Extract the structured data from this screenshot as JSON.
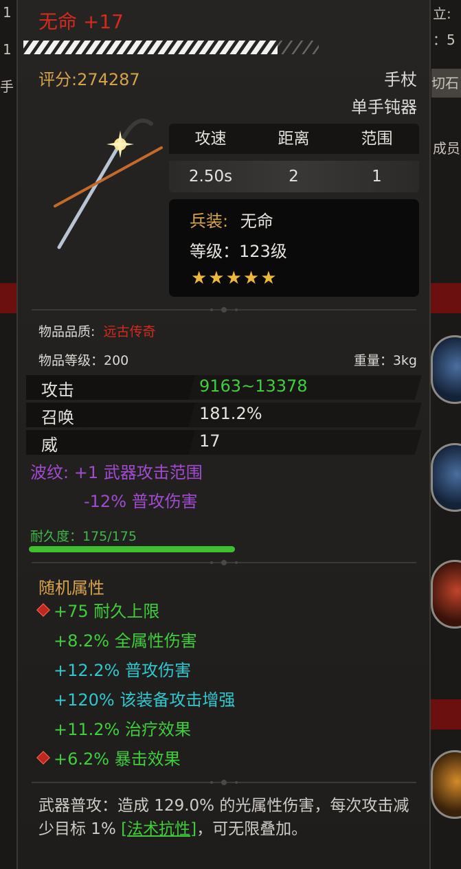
{
  "item": {
    "title": "无命 +17",
    "score": "评分:274287",
    "weapon_type": "手杖",
    "weapon_class": "单手钝器"
  },
  "combat_stats": {
    "headers": [
      "攻速",
      "距离",
      "范围"
    ],
    "values": [
      "2.50s",
      "2",
      "1"
    ]
  },
  "info_box": {
    "equip_label": "兵装:",
    "equip_value": "无命",
    "level_text": "等级：123级",
    "stars": "★★★★★",
    "star_count": 5
  },
  "quality": {
    "label": "物品品质:",
    "value": "远古传奇"
  },
  "item_level": "物品等级：200",
  "weight": "重量：3kg",
  "attributes": [
    {
      "name": "攻击",
      "value": "9163~13378",
      "color": "#3fcf3a"
    },
    {
      "name": "召唤",
      "value": "181.2%",
      "color": "#e6e3de"
    },
    {
      "name": "威",
      "value": "17",
      "color": "#e6e3de"
    }
  ],
  "ripple": {
    "line1": "波纹: +1 武器攻击范围",
    "line2": "-12% 普攻伤害"
  },
  "durability": {
    "label": "耐久度：175/175",
    "current": 175,
    "max": 175
  },
  "random_attributes": {
    "title": "随机属性",
    "lines": [
      {
        "text": "+75 耐久上限",
        "color": "#3fcf3a",
        "gem": true
      },
      {
        "text": "+8.2% 全属性伤害",
        "color": "#3fcf3a",
        "gem": false
      },
      {
        "text": "+12.2% 普攻伤害",
        "color": "#2fc7d0",
        "gem": false
      },
      {
        "text": "+120% 该装备攻击增强",
        "color": "#2fc7d0",
        "gem": false
      },
      {
        "text": "+11.2% 治疗效果",
        "color": "#3fcf3a",
        "gem": false
      },
      {
        "text": "+6.2% 暴击效果",
        "color": "#3fcf3a",
        "gem": true
      }
    ]
  },
  "description": {
    "part1": "武器普攻：造成 129.0% 的光属性伤害，每次攻击减少目标 1% ",
    "link": "[法术抗性]",
    "part2": "，可无限叠加。"
  },
  "side_left": [
    "1",
    "1",
    "手"
  ],
  "side_right": [
    "立:",
    "：5",
    "切石",
    "成员"
  ]
}
